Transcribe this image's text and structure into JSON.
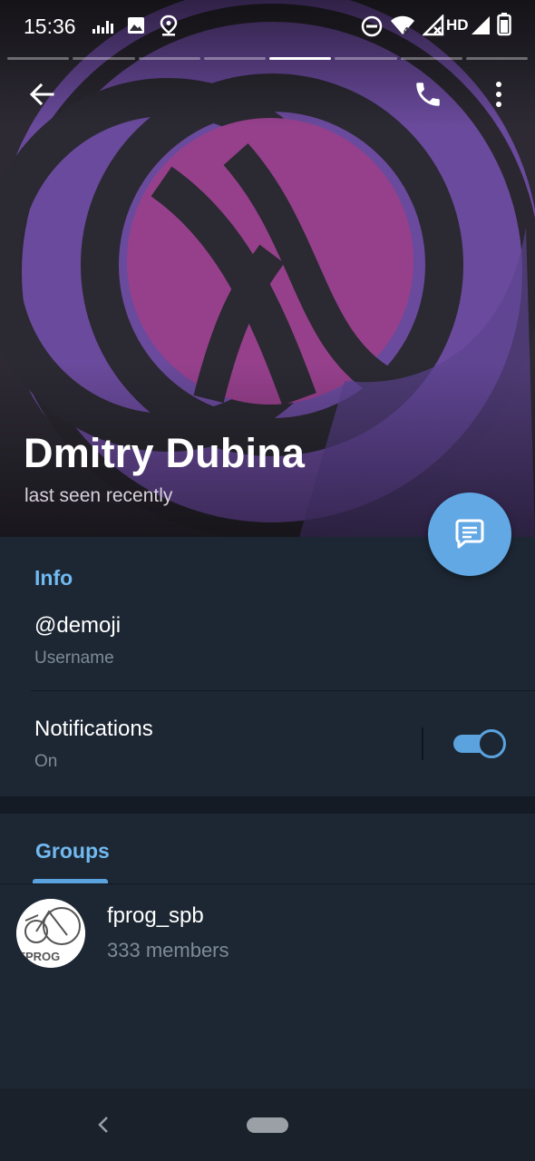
{
  "status_bar": {
    "time": "15:36",
    "network_label": "HD",
    "icons": [
      "equalizer-icon",
      "image-icon",
      "location-icon",
      "do-not-disturb-icon",
      "wifi-icon",
      "signal-icon",
      "battery-icon"
    ]
  },
  "story_bars": {
    "count": 8,
    "active_index": 4
  },
  "header": {
    "name": "Dmitry Dubina",
    "status": "last seen recently",
    "icons": [
      "back-arrow-icon",
      "phone-icon",
      "more-vert-icon"
    ]
  },
  "info": {
    "title": "Info",
    "username_value": "@demoji",
    "username_label": "Username",
    "notifications_label": "Notifications",
    "notifications_state": "On",
    "notifications_enabled": true
  },
  "groups": {
    "tab_label": "Groups",
    "items": [
      {
        "name": "fprog_spb",
        "members": "333 members",
        "avatar_text": "FPROG"
      }
    ]
  },
  "colors": {
    "accent": "#71b9f1",
    "fab": "#62a8e4",
    "background": "#1d2733",
    "avatar_purple": "#96408c",
    "avatar_violet": "#6a4a9c"
  }
}
